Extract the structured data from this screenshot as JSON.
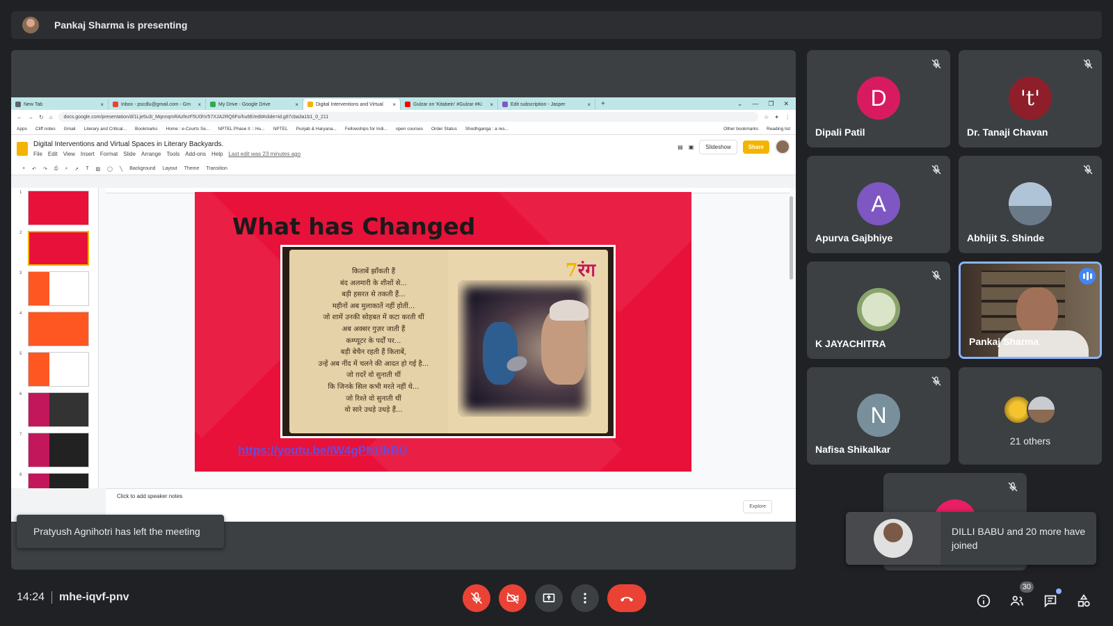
{
  "presenting_bar": {
    "text": "Pankaj Sharma is presenting"
  },
  "browser": {
    "tabs": [
      {
        "label": "New Tab",
        "color": "#5f6368"
      },
      {
        "label": "Inbox - pscdlu@gmail.com - Gm",
        "color": "#ea4335"
      },
      {
        "label": "My Drive - Google Drive",
        "color": "#34a853"
      },
      {
        "label": "Digital Interventions and Virtual",
        "color": "#f4b400"
      },
      {
        "label": "Gulzar on 'Kitabein' #Gulzar #Ki",
        "color": "#ff0000"
      },
      {
        "label": "Edit subscription - Jasper",
        "color": "#7e57c2"
      }
    ],
    "url": "docs.google.com/presentation/d/1Lje5u3i_MqnnqmRAzfezF5U0hV57XJA2RQ6Fo/hu6E/edit#slide=id.g87cba3a1b1_0_211",
    "bookmarks": [
      "Apps",
      "Cliff notes",
      "Gmail",
      "Literary and Critical...",
      "Bookmarks",
      "Home : e-Courts Se...",
      "NPTEL Phase II :: Hu...",
      "NPTEL",
      "Punjab & Haryana...",
      "Fellowships for Indi...",
      "open courses",
      "Order Status",
      "Shodhganga : a res...",
      "Other bookmarks",
      "Reading list"
    ]
  },
  "slides_app": {
    "title": "Digital Interventions and Virtual Spaces in Literary Backyards.",
    "menu": [
      "File",
      "Edit",
      "View",
      "Insert",
      "Format",
      "Slide",
      "Arrange",
      "Tools",
      "Add-ons",
      "Help"
    ],
    "last_edit": "Last edit was 23 minutes ago",
    "slideshow_label": "Slideshow",
    "share_label": "Share",
    "toolbar": [
      "Background",
      "Layout",
      "Theme",
      "Transition"
    ],
    "speaker_notes": "Click to add speaker notes",
    "explore_label": "Explore",
    "thumb_numbers": [
      "1",
      "2",
      "3",
      "4",
      "5",
      "6",
      "7",
      "8"
    ]
  },
  "slide": {
    "title": "What has Changed",
    "logo_text": "रंग",
    "poem": [
      "किताबें झाँकती हैं",
      "बंद अलमारी के शीशों से...",
      "बड़ी हसरत से तकती हैं...",
      "महीनों अब मुलाकातें नहीं होतीं...",
      "जो शामें उनकी सोहबत में कटा करती थीं",
      "अब अक्सर गुज़र जाती हैं",
      "कम्प्यूटर के पर्दों पर...",
      "बड़ी बेचैन रहती हैं किताबें,",
      "उन्हें अब नींद में चलने की आदत हो गई है...",
      "जो ग़दरें वो सुनाती थीं",
      "कि जिनके सिल कभी मरते नहीं थे...",
      "जो रिश्ते वो सुनाती थीं",
      "वो सारे उधड़े उधड़े हैं..."
    ],
    "link": "https://youtu.be/iW4gPb1lbBU"
  },
  "toast": {
    "text": "Pratyush Agnihotri has left the meeting"
  },
  "participants": [
    {
      "name": "Dipali Patil",
      "initial": "D",
      "color": "#d81b60"
    },
    {
      "name": "Dr. Tanaji Chavan",
      "initial": "'t'",
      "color": "#8e1f2a"
    },
    {
      "name": "Apurva Gajbhiye",
      "initial": "A",
      "color": "#7e57c2"
    },
    {
      "name": "Abhijit S. Shinde",
      "initial": "",
      "color": "#90a4ae"
    },
    {
      "name": "K JAYACHITRA",
      "initial": "",
      "color": "#c5d6b0"
    },
    {
      "name": "Pankaj Sharma",
      "initial": "",
      "color": "#5a4a3c"
    },
    {
      "name": "Nafisa Shikalkar",
      "initial": "N",
      "color": "#78909c"
    }
  ],
  "others": {
    "label": "21 others"
  },
  "join_toast": {
    "text": "DILLI BABU and 20 more have joined"
  },
  "bottom_bar": {
    "time": "14:24",
    "meeting_code": "mhe-iqvf-pnv",
    "people_count": "30"
  }
}
